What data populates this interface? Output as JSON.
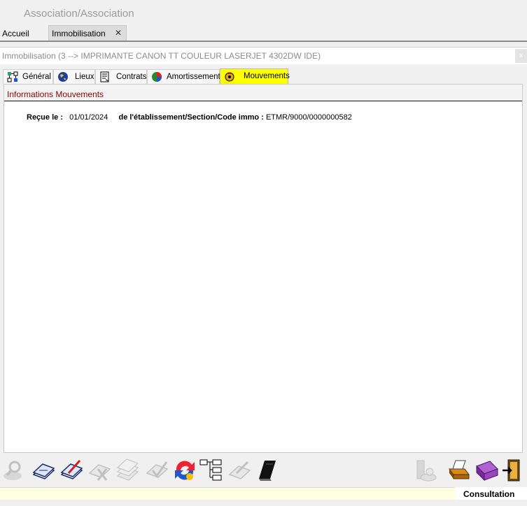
{
  "app": {
    "title": "Association/Association"
  },
  "main_tabs": [
    {
      "label": "Accueil"
    },
    {
      "label": "Immobilisation",
      "close": "✕"
    }
  ],
  "window": {
    "title": "Immobilisation (3 --> IMPRIMANTE CANON TT COULEUR LASERJET 4302DW IDE)",
    "close_label": "x"
  },
  "detail_tabs": [
    {
      "label": "Général",
      "icon": "general-icon"
    },
    {
      "label": "Lieux",
      "icon": "globe-icon"
    },
    {
      "label": "Contrats",
      "icon": "contract-icon"
    },
    {
      "label": "Amortissements",
      "icon": "pie-chart-icon"
    },
    {
      "label": "Mouvements",
      "icon": "movement-icon",
      "active": true
    }
  ],
  "section": {
    "title": "Informations Mouvements",
    "received_label": "Reçue le :",
    "received_value": "01/01/2024",
    "origin_label": "de l'établissement/Section/Code immo :",
    "origin_value": "ETMR/9000/0000000582"
  },
  "toolbar": {
    "left": [
      "search-icon",
      "view-document-icon",
      "edit-document-icon",
      "delete-document-icon",
      "stack-icon",
      "validate-icon",
      "refresh-icon",
      "tree-icon",
      "pen-icon",
      "book-icon"
    ],
    "right": [
      "settings-icon",
      "print-icon",
      "folder-icon",
      "exit-icon"
    ]
  },
  "status": {
    "mode": "Consultation"
  },
  "colors": {
    "active_tab": "#ffff00",
    "section_title": "#8b0000",
    "status_bg": "#ffffe4"
  }
}
